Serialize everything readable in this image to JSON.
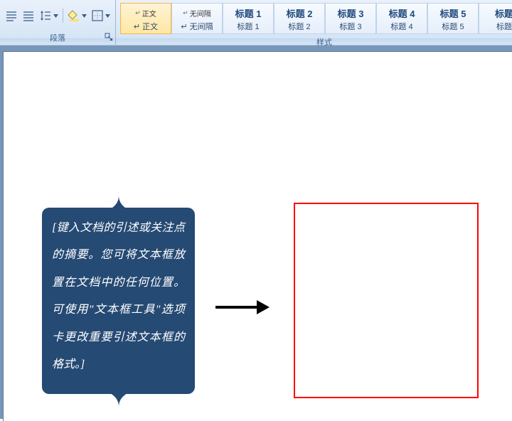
{
  "ribbon": {
    "paragraph": {
      "label": "段落",
      "buttons": {
        "align_justify": "align-justify",
        "align_distribute": "align-distribute",
        "line_spacing": "line-spacing",
        "shading": "shading",
        "borders": "borders"
      }
    },
    "styles": {
      "label": "样式",
      "items": [
        {
          "marker": "↵",
          "preview": "正文",
          "name": "↵ 正文",
          "selected": true,
          "blue": false
        },
        {
          "marker": "↵",
          "preview": "无间隔",
          "name": "↵ 无间隔",
          "selected": false,
          "blue": false
        },
        {
          "marker": "",
          "preview": "标题 1",
          "name": "标题 1",
          "selected": false,
          "blue": true
        },
        {
          "marker": "",
          "preview": "标题 2",
          "name": "标题 2",
          "selected": false,
          "blue": true
        },
        {
          "marker": "",
          "preview": "标题 3",
          "name": "标题 3",
          "selected": false,
          "blue": true
        },
        {
          "marker": "",
          "preview": "标题 4",
          "name": "标题 4",
          "selected": false,
          "blue": true
        },
        {
          "marker": "",
          "preview": "标题 5",
          "name": "标题 5",
          "selected": false,
          "blue": true
        },
        {
          "marker": "",
          "preview": "标题",
          "name": "标题",
          "selected": false,
          "blue": true
        }
      ]
    }
  },
  "document": {
    "callout_text": "[键入文档的引述或关注点的摘要。您可将文本框放置在文档中的任何位置。可使用\"文本框工具\"选项卡更改重要引述文本框的格式。]"
  }
}
